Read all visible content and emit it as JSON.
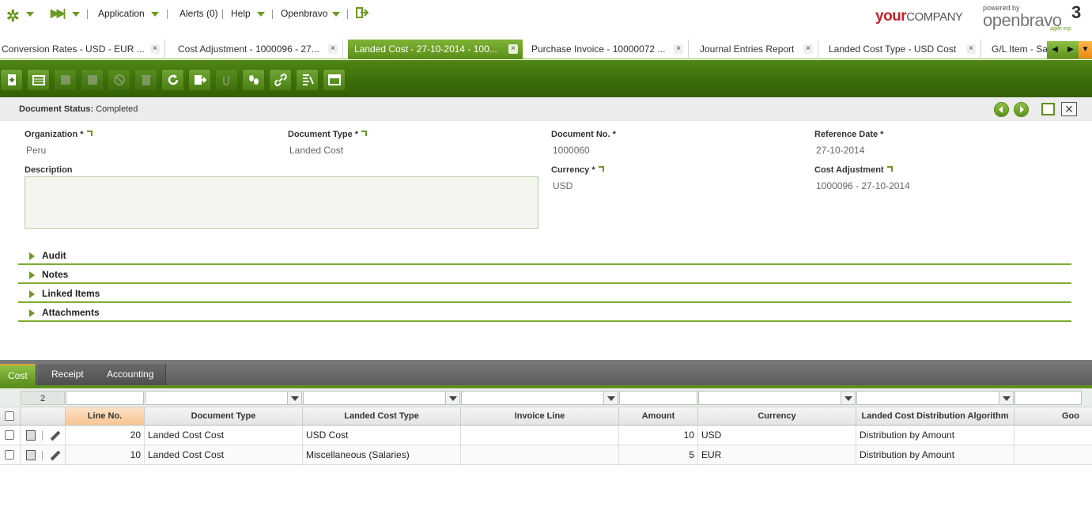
{
  "topbar": {
    "application": "Application",
    "alerts": "Alerts (0)",
    "help": "Help",
    "openbravo": "Openbravo",
    "brand_your": "your",
    "brand_company": "COMPANY",
    "powered_by": "powered by",
    "openbravo_logo": "openbravo",
    "logo_version": "3",
    "logo_tagline": "agile erp"
  },
  "tabs": [
    {
      "label": "Conversion Rates - USD - EUR ..."
    },
    {
      "label": "Cost Adjustment - 1000096 - 27..."
    },
    {
      "label": "Landed Cost - 27-10-2014 - 100..."
    },
    {
      "label": "Purchase Invoice - 10000072 ..."
    },
    {
      "label": "Journal Entries Report"
    },
    {
      "label": "Landed Cost Type - USD Cost"
    },
    {
      "label": "G/L Item - Sa"
    }
  ],
  "active_tab_index": 2,
  "status": {
    "label": "Document Status:",
    "value": "Completed"
  },
  "form": {
    "organization_label": "Organization *",
    "organization_value": "Peru",
    "document_type_label": "Document Type *",
    "document_type_value": "Landed Cost",
    "document_no_label": "Document No. *",
    "document_no_value": "1000060",
    "reference_date_label": "Reference Date *",
    "reference_date_value": "27-10-2014",
    "description_label": "Description",
    "description_value": "",
    "currency_label": "Currency *",
    "currency_value": "USD",
    "cost_adjustment_label": "Cost Adjustment",
    "cost_adjustment_value": "1000096 - 27-10-2014"
  },
  "sections": [
    {
      "label": "Audit"
    },
    {
      "label": "Notes"
    },
    {
      "label": "Linked Items"
    },
    {
      "label": "Attachments"
    }
  ],
  "child_tabs": [
    {
      "label": "Cost"
    },
    {
      "label": "Receipt"
    },
    {
      "label": "Accounting"
    }
  ],
  "grid": {
    "record_count": "2",
    "columns": [
      "Line No.",
      "Document Type",
      "Landed Cost Type",
      "Invoice Line",
      "Amount",
      "Currency",
      "Landed Cost Distribution Algorithm",
      "Goo"
    ],
    "rows": [
      {
        "line_no": "20",
        "document_type": "Landed Cost Cost",
        "landed_cost_type": "USD Cost",
        "invoice_line": "",
        "amount": "10",
        "currency": "USD",
        "algorithm": "Distribution by Amount"
      },
      {
        "line_no": "10",
        "document_type": "Landed Cost Cost",
        "landed_cost_type": "Miscellaneous (Salaries)",
        "invoice_line": "",
        "amount": "5",
        "currency": "EUR",
        "algorithm": "Distribution by Amount"
      }
    ]
  },
  "colors": {
    "accent": "#5d8f1c",
    "toolbar": "#3c6b0a",
    "brand_red": "#c7202a"
  }
}
